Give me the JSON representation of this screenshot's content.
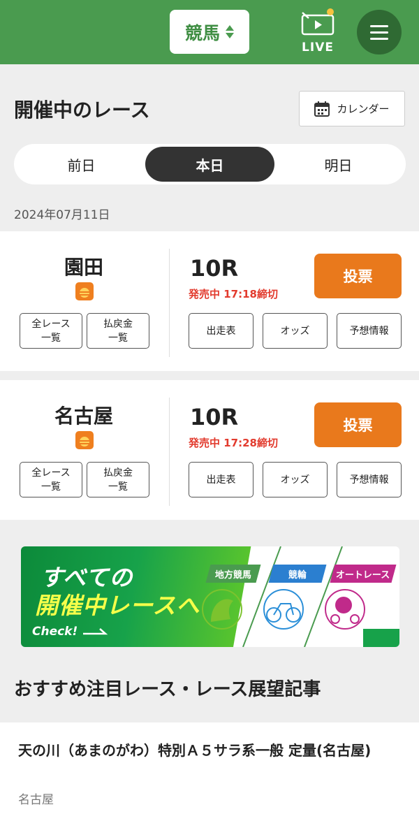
{
  "header": {
    "sport_select": "競馬",
    "live_label": "LIVE"
  },
  "section": {
    "title": "開催中のレース",
    "calendar_label": "カレンダー"
  },
  "day_tabs": [
    {
      "label": "前日",
      "active": false
    },
    {
      "label": "本日",
      "active": true
    },
    {
      "label": "明日",
      "active": false
    }
  ],
  "date": "2024年07月11日",
  "races": [
    {
      "venue": "園田",
      "all_races_label": "全レース\n一覧",
      "payout_label": "払戻金\n一覧",
      "race_no": "10R",
      "status": "発売中 17:18締切",
      "vote_label": "投票",
      "entries_label": "出走表",
      "odds_label": "オッズ",
      "forecast_label": "予想情報"
    },
    {
      "venue": "名古屋",
      "all_races_label": "全レース\n一覧",
      "payout_label": "払戻金\n一覧",
      "race_no": "10R",
      "status": "発売中 17:28締切",
      "vote_label": "投票",
      "entries_label": "出走表",
      "odds_label": "オッズ",
      "forecast_label": "予想情報"
    }
  ],
  "banner": {
    "line1": "すべての",
    "line2": "開催中レースへ",
    "check": "Check!",
    "categories": [
      "地方競馬",
      "競輪",
      "オートレース"
    ]
  },
  "featured": {
    "title": "おすすめ注目レース・レース展望記事",
    "item_title": "天の川（あまのがわ）特別Ａ５サラ系一般 定量(名古屋)",
    "item_venue": "名古屋"
  },
  "colors": {
    "header_green": "#4a9b4f",
    "vote_orange": "#e9791c",
    "status_red": "#e23b2e"
  }
}
